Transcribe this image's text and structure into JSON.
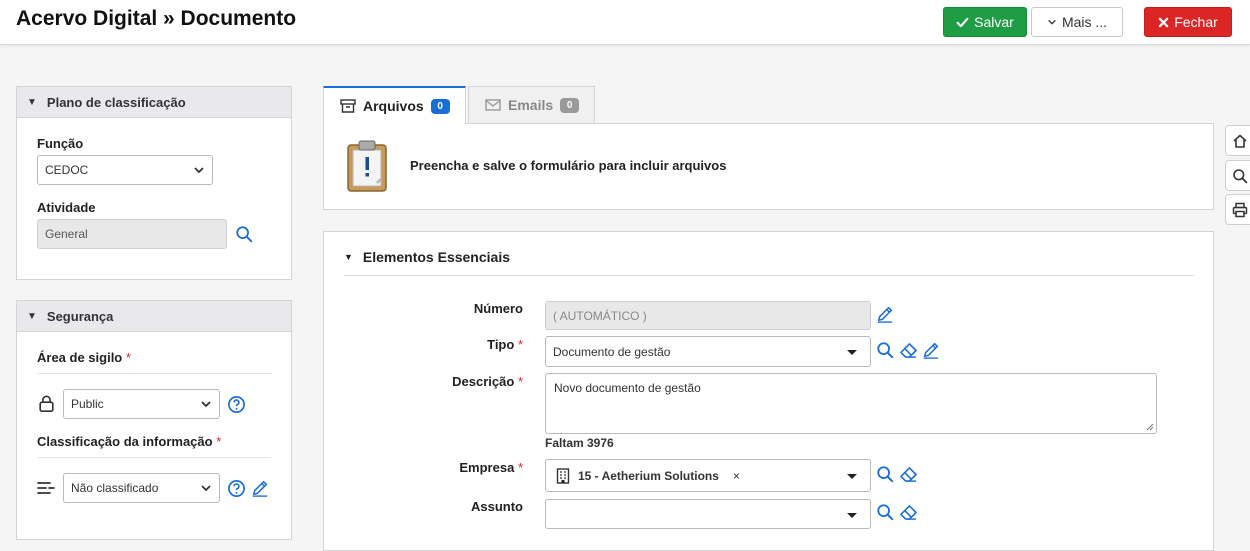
{
  "header": {
    "title": "Acervo Digital » Documento",
    "save_label": "Salvar",
    "more_label": "Mais ...",
    "close_label": "Fechar"
  },
  "classification_panel": {
    "title": "Plano de classificação",
    "funcao_label": "Função",
    "funcao_value": "CEDOC",
    "atividade_label": "Atividade",
    "atividade_value": "General"
  },
  "security_panel": {
    "title": "Segurança",
    "sigilo_label": "Área de sigilo",
    "sigilo_value": "Public",
    "classificacao_label": "Classificação da informação",
    "classificacao_value": "Não classificado"
  },
  "tabs": [
    {
      "label": "Arquivos",
      "count": "0",
      "icon": "archive-icon"
    },
    {
      "label": "Emails",
      "count": "0",
      "icon": "envelope-icon"
    }
  ],
  "files_panel": {
    "message": "Preencha e salve o formulário para incluir arquivos"
  },
  "essential": {
    "title": "Elementos Essenciais",
    "numero_label": "Número",
    "numero_value": "( AUTOMÁTICO )",
    "tipo_label": "Tipo",
    "tipo_value": "Documento de gestão",
    "descricao_label": "Descrição",
    "descricao_value": "Novo documento de gestão",
    "faltam_text": "Faltam 3976",
    "empresa_label": "Empresa",
    "empresa_value": "15 - Aetherium Solutions",
    "empresa_remove": "×",
    "assunto_label": "Assunto",
    "assunto_value": ""
  },
  "required_mark": "*",
  "colors": {
    "accent_blue": "#1a6fd6",
    "save_green": "#1f9d44",
    "close_red": "#dc2626",
    "panel_header": "#e9e9ed"
  }
}
